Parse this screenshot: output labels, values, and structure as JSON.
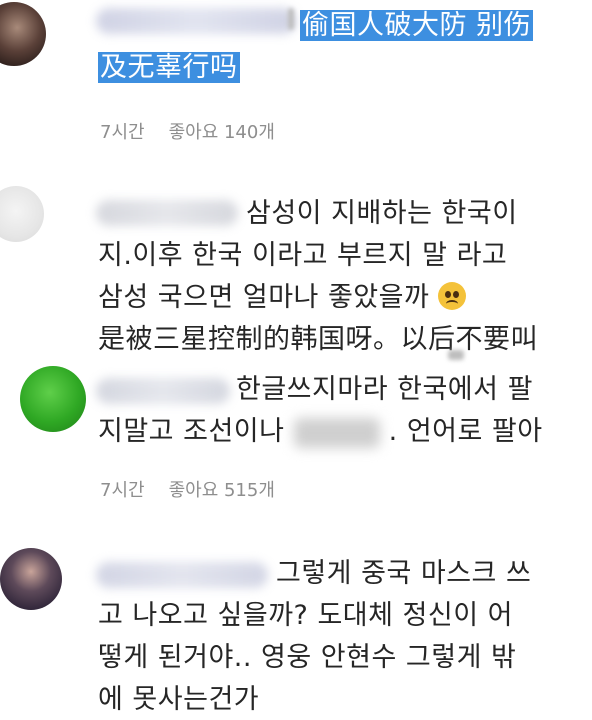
{
  "comments": [
    {
      "lines": [
        "偷国人破大防 别伤",
        "及无辜行吗"
      ],
      "time": "7시간",
      "likes": "좋아요 140개"
    },
    {
      "lines": [
        "삼성이 지배하는 한국이",
        "지.이후 한국 이라고 부르지 말 라고",
        "삼성 국으면 얼마나 좋았을까",
        "是被三星控制的韩国呀。以后不要叫"
      ],
      "emoji": "pleading-face-icon"
    },
    {
      "lines": [
        "한글쓰지마라 한국에서 팔",
        "지말고 조선이나",
        ". 언어로 팔아"
      ],
      "time": "7시간",
      "likes": "좋아요 515개"
    },
    {
      "lines": [
        "그렇게 중국 마스크 쓰",
        "고 나오고 싶을까? 도대체 정신이 어",
        "떻게 된거야.. 영웅 안현수 그렇게 밖",
        "에 못사는건가"
      ]
    }
  ],
  "colors": {
    "highlight": "#3d8fe0",
    "meta_text": "#8e8e8e",
    "body_text": "#262626"
  }
}
